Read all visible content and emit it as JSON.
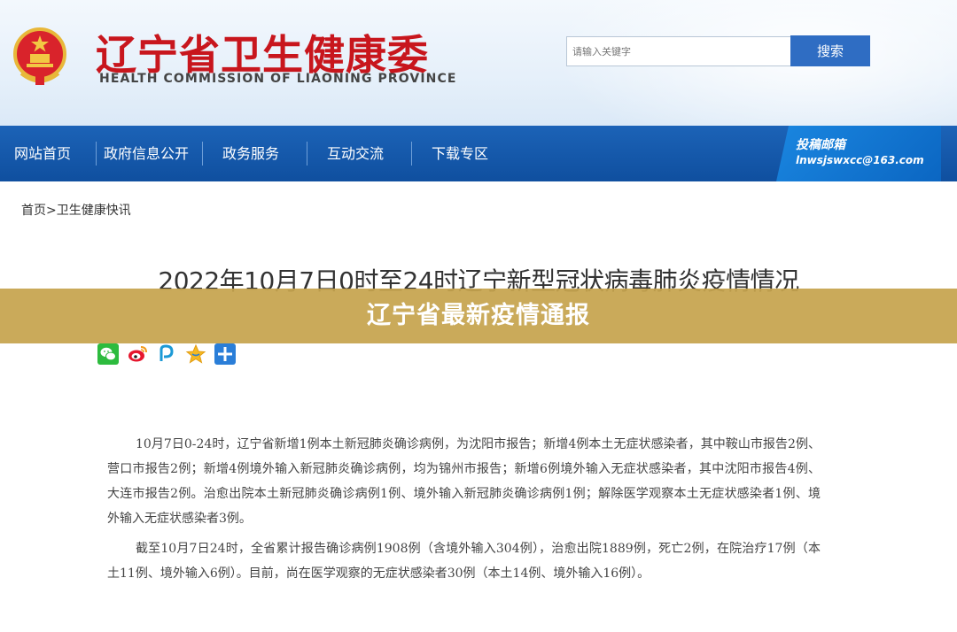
{
  "header": {
    "title": "辽宁省卫生健康委",
    "subtitle": "HEALTH COMMISSION OF LIAONING PROVINCE",
    "emblem_icon": "national-emblem-icon",
    "search": {
      "placeholder": "请输入关键字",
      "value": "",
      "button_label": "搜索"
    }
  },
  "nav": {
    "items": [
      {
        "label": "网站首页"
      },
      {
        "label": "政府信息公开"
      },
      {
        "label": "政务服务"
      },
      {
        "label": "互动交流"
      },
      {
        "label": "下载专区"
      }
    ],
    "mailbox": {
      "label": "投稿邮箱",
      "email": "lnwsjswxcc@163.com"
    }
  },
  "breadcrumb": {
    "home": "首页",
    "separator": ">",
    "current": "卫生健康快讯"
  },
  "article": {
    "title": "2022年10月7日0时至24时辽宁新型冠状病毒肺炎疫情情况",
    "banner": "辽宁省最新疫情通报",
    "share_icons": [
      "wechat-icon",
      "weibo-icon",
      "qzone-icon",
      "favorite-star-icon",
      "more-plus-icon"
    ],
    "paragraphs": [
      "10月7日0-24时，辽宁省新增1例本土新冠肺炎确诊病例，为沈阳市报告；新增4例本土无症状感染者，其中鞍山市报告2例、营口市报告2例；新增4例境外输入新冠肺炎确诊病例，均为锦州市报告；新增6例境外输入无症状感染者，其中沈阳市报告4例、大连市报告2例。治愈出院本土新冠肺炎确诊病例1例、境外输入新冠肺炎确诊病例1例；解除医学观察本土无症状感染者1例、境外输入无症状感染者3例。",
      "截至10月7日24时，全省累计报告确诊病例1908例（含境外输入304例），治愈出院1889例，死亡2例，在院治疗17例（本土11例、境外输入6例）。目前，尚在医学观察的无症状感染者30例（本土14例、境外输入16例）。"
    ]
  },
  "colors": {
    "title_red": "#c8161d",
    "nav_blue": "#1c63b7",
    "button_blue": "#2f6dc3",
    "banner_gold": "#c6a44e"
  }
}
